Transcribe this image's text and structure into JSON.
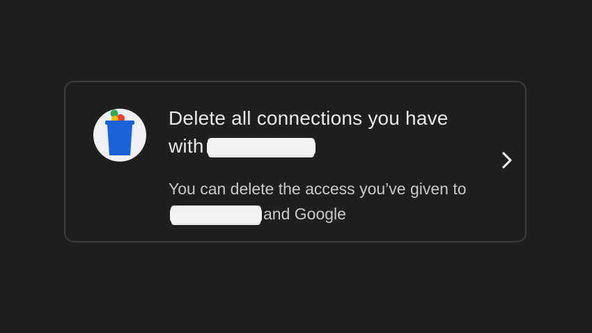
{
  "card": {
    "title_before_redaction": "Delete all connections you have with",
    "subtitle_before_redaction": "You can delete the access you’ve given to",
    "subtitle_after_redaction": "and Google"
  },
  "colors": {
    "background": "#1f1f1f",
    "card_border": "#3c3c3c",
    "title_text": "#e8e8e8",
    "subtitle_text": "#c9c9c9",
    "icon_circle": "#eef0f4",
    "trash_blue": "#1a63d6",
    "dot_green": "#34a853",
    "dot_red": "#ea4335",
    "dot_yellow": "#fbbc04"
  },
  "icons": {
    "leading": "trash-can-icon",
    "trailing": "chevron-right-icon"
  }
}
